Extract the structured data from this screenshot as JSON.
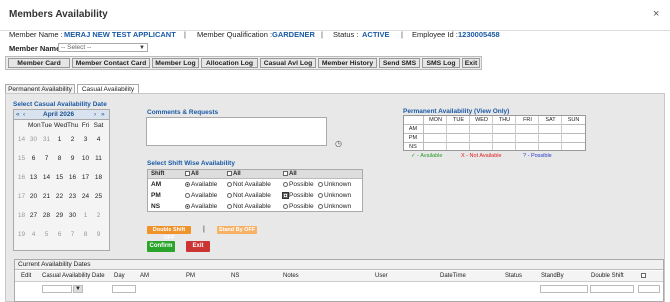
{
  "window": {
    "title": "Members Availability",
    "close_glyph": "×"
  },
  "info": {
    "member_name_label": "Member Name :",
    "member_name_value": "MERAJ NEW TEST APPLICANT",
    "qualification_label": "Member Qualification :",
    "qualification_value": "GARDENER",
    "status_label": "Status :",
    "status_value": "ACTIVE",
    "employee_label": "Employee Id :",
    "employee_value": "1230005458",
    "separator": "|"
  },
  "member_select": {
    "label": "Member Name",
    "value": "-- Select --"
  },
  "toolbar": [
    "Member Card",
    "Member Contact Card",
    "Member Log",
    "Allocation Log",
    "Casual Avl Log",
    "Member History",
    "Send SMS",
    "SMS Log",
    "Exit"
  ],
  "tabs": [
    {
      "label": "Permanent Availability",
      "active": false
    },
    {
      "label": "Casual Availability",
      "active": true
    }
  ],
  "calendar": {
    "section_title": "Select Casual Availability Date",
    "nav_prev_year": "«",
    "nav_prev_month": "‹",
    "month_label": "April 2026",
    "nav_next_month": "›",
    "nav_next_year": "»",
    "weekdays": [
      "Mon",
      "Tue",
      "Wed",
      "Thu",
      "Fri",
      "Sat"
    ],
    "weeks": [
      {
        "wk": "14",
        "days": [
          "30",
          "31",
          "1",
          "2",
          "3",
          "4"
        ]
      },
      {
        "wk": "15",
        "days": [
          "6",
          "7",
          "8",
          "9",
          "10",
          "11"
        ]
      },
      {
        "wk": "16",
        "days": [
          "13",
          "14",
          "15",
          "16",
          "17",
          "18"
        ]
      },
      {
        "wk": "17",
        "days": [
          "20",
          "21",
          "22",
          "23",
          "24",
          "25"
        ]
      },
      {
        "wk": "18",
        "days": [
          "27",
          "28",
          "29",
          "30",
          "1",
          "2"
        ]
      },
      {
        "wk": "19",
        "days": [
          "4",
          "5",
          "6",
          "7",
          "8",
          "9"
        ]
      }
    ]
  },
  "comments": {
    "title": "Comments & Requests",
    "value": ""
  },
  "shift_wise": {
    "title": "Select Shift Wise Availability",
    "header": {
      "shift": "Shift",
      "all": "All"
    },
    "options": [
      "Available",
      "Not Available",
      "Possible",
      "Unknown"
    ],
    "rows": [
      {
        "shift": "AM",
        "selected": "Available"
      },
      {
        "shift": "PM",
        "selected": "Possible"
      },
      {
        "shift": "NS",
        "selected": "Available"
      }
    ]
  },
  "buttons": {
    "double_shift": "Double Shift OFF",
    "divider": "|",
    "stand_by": "Stand By OFF",
    "confirm": "Confirm",
    "exit": "Exit",
    "double_color": "#f0932b",
    "stand_color": "#f7b267",
    "confirm_color": "#2aa52a",
    "exit_color": "#cc3333"
  },
  "permanent": {
    "title": "Permanent Availability (View Only)",
    "days": [
      "MON",
      "TUE",
      "WED",
      "THU",
      "FRI",
      "SAT",
      "SUN"
    ],
    "shifts": [
      "AM",
      "PM",
      "NS"
    ],
    "legend": {
      "available": "✓ - Available",
      "not": "X - Not Available",
      "possible": "? - Possible"
    }
  },
  "grid": {
    "title": "Current Availability Dates",
    "columns": [
      "Edit",
      "Casual Availability Date",
      "Day",
      "AM",
      "PM",
      "NS",
      "Notes",
      "User",
      "DateTime",
      "Status",
      "StandBy",
      "Double Shift"
    ]
  }
}
